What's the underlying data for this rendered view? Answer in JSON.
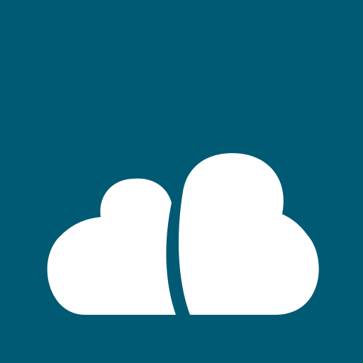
{
  "app_icon": {
    "icon": "cloud-icon",
    "colors": {
      "background": "#005a73",
      "glyph": "#ffffff"
    }
  }
}
